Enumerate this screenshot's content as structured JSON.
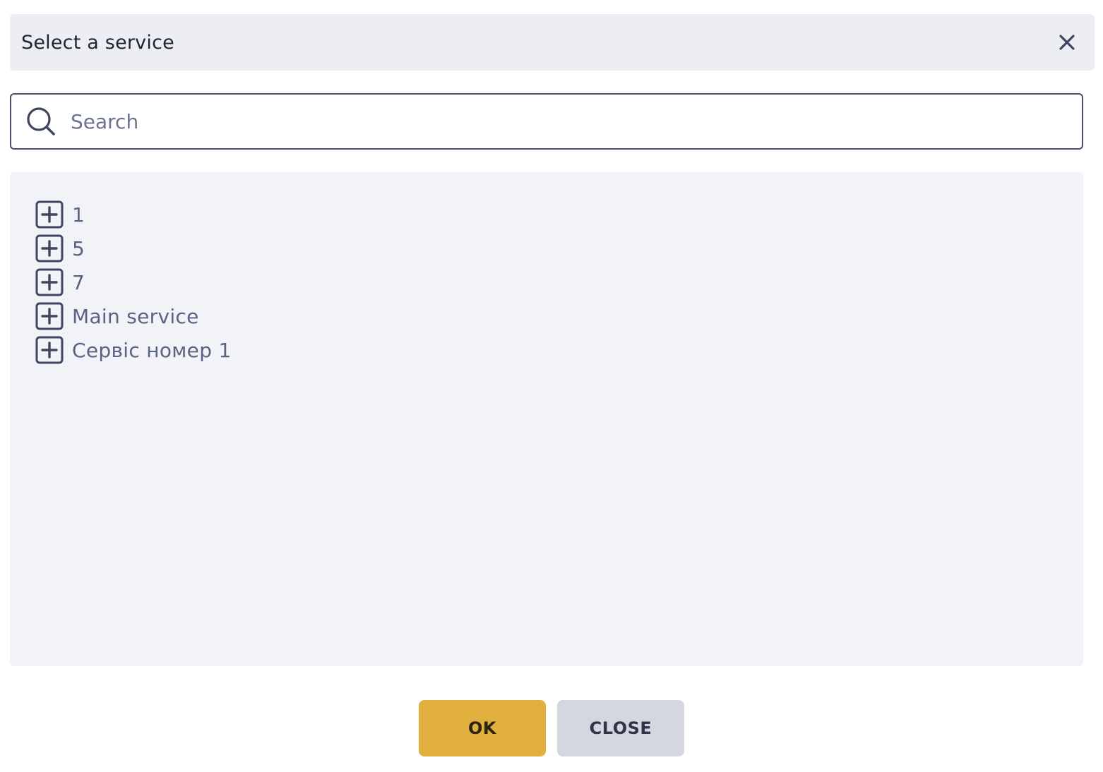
{
  "dialog": {
    "title": "Select a service",
    "close_icon": "close-icon"
  },
  "search": {
    "placeholder": "Search",
    "value": "",
    "icon": "search-icon"
  },
  "tree": {
    "expand_icon": "plus-square-icon",
    "items": [
      {
        "label": "1"
      },
      {
        "label": "5"
      },
      {
        "label": "7"
      },
      {
        "label": "Main service"
      },
      {
        "label": "Сервіс номер 1"
      }
    ]
  },
  "footer": {
    "ok_label": "OK",
    "close_label": "CLOSE"
  },
  "colors": {
    "accent": "#e2b03e",
    "header_bg": "#edeef3",
    "panel_bg": "#f2f3f7",
    "secondary_button": "#d4d6e0",
    "icon": "#3e4660",
    "label": "#5a6384"
  }
}
